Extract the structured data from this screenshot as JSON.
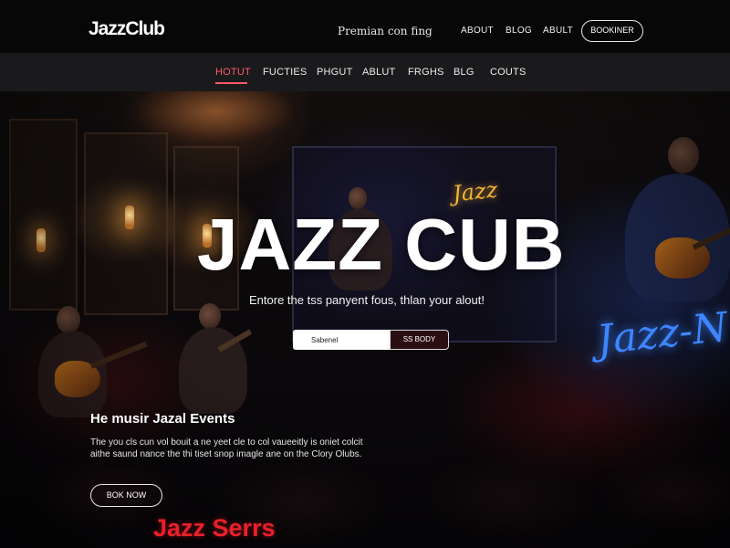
{
  "brand": {
    "logo": "JazzClub",
    "tagline": "Premian con fing"
  },
  "top_nav": {
    "items": [
      "ABOUT",
      "BLOG",
      "ABULT"
    ],
    "booking_label": "BOOKINER"
  },
  "sub_nav": {
    "items": [
      "HOTUT",
      "FUCTIES",
      "PHGUT",
      "ABLUT",
      "FRGHS",
      "BLG",
      "COUTS"
    ],
    "active_index": 0
  },
  "hero": {
    "title": "JAZZ CUB",
    "subtitle": "Entore the tss panyent fous, thlan your alout!",
    "email_value": "Sabenel",
    "subscribe_label": "SS BODY"
  },
  "events": {
    "heading": "He musir Jazal Events",
    "body": "The you cls cun vol bouit a ne yeet cle to col vaueeitly is oniet colcit aithe saund nance the thi tiset snop imagle ane on the Clory Olubs.",
    "book_label": "BOK NOW",
    "series_title": "Jazz Serrs"
  },
  "signage": {
    "neon_small": "Jazz",
    "neon_large": "Jazz-N"
  },
  "colors": {
    "accent": "#ff5a6a",
    "series_red": "#e8202a",
    "neon_blue": "#3d86ff",
    "neon_yellow": "#f2b431"
  },
  "icons": []
}
